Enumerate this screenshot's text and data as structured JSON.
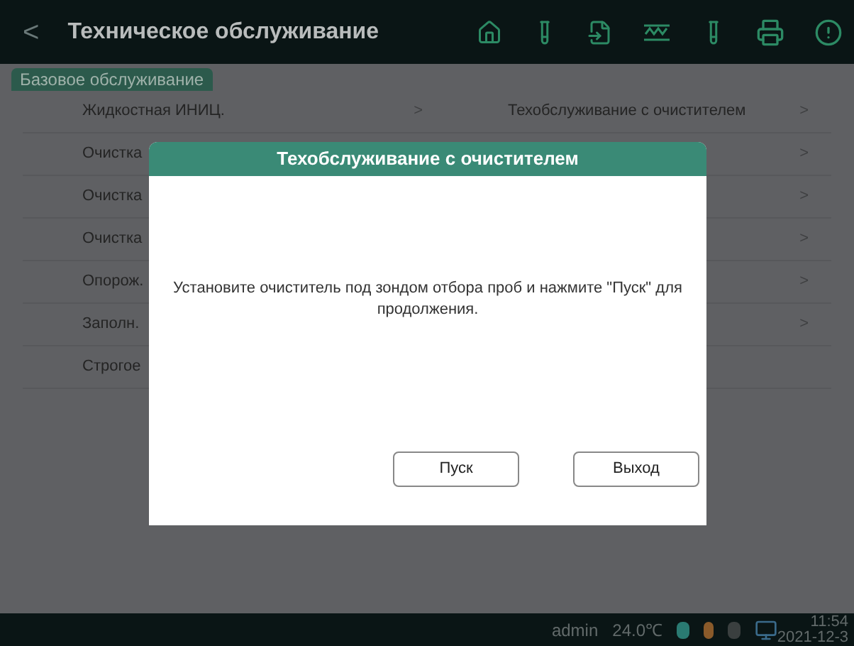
{
  "header": {
    "back": "<",
    "title": "Техническое обслуживание"
  },
  "tabs": [
    {
      "label": "Базовое обслуживание",
      "selected": true
    }
  ],
  "rows": [
    {
      "left": "Жидкостная ИНИЦ.",
      "left_chevron": ">",
      "right": "Техобслуживание с очистителем",
      "right_chevron": ">"
    },
    {
      "left": "Очистка",
      "right_chevron": ">"
    },
    {
      "left": "Очистка",
      "right_chevron": ">"
    },
    {
      "left": "Очистка",
      "right_chevron": ">"
    },
    {
      "left": "Опорож.",
      "right_chevron": ">"
    },
    {
      "left": "Заполн.",
      "right_chevron": ">"
    },
    {
      "left": "Строгое"
    }
  ],
  "dialog": {
    "title": "Техобслуживание с очистителем",
    "message": "Установите очиститель под зондом отбора проб и нажмите \"Пуск\" для продолжения.",
    "buttons": [
      "Пуск",
      "Выход"
    ]
  },
  "status_bar": {
    "user": "admin",
    "temperature": "24.0℃",
    "time": "11:54",
    "date": "2021-12-3"
  }
}
